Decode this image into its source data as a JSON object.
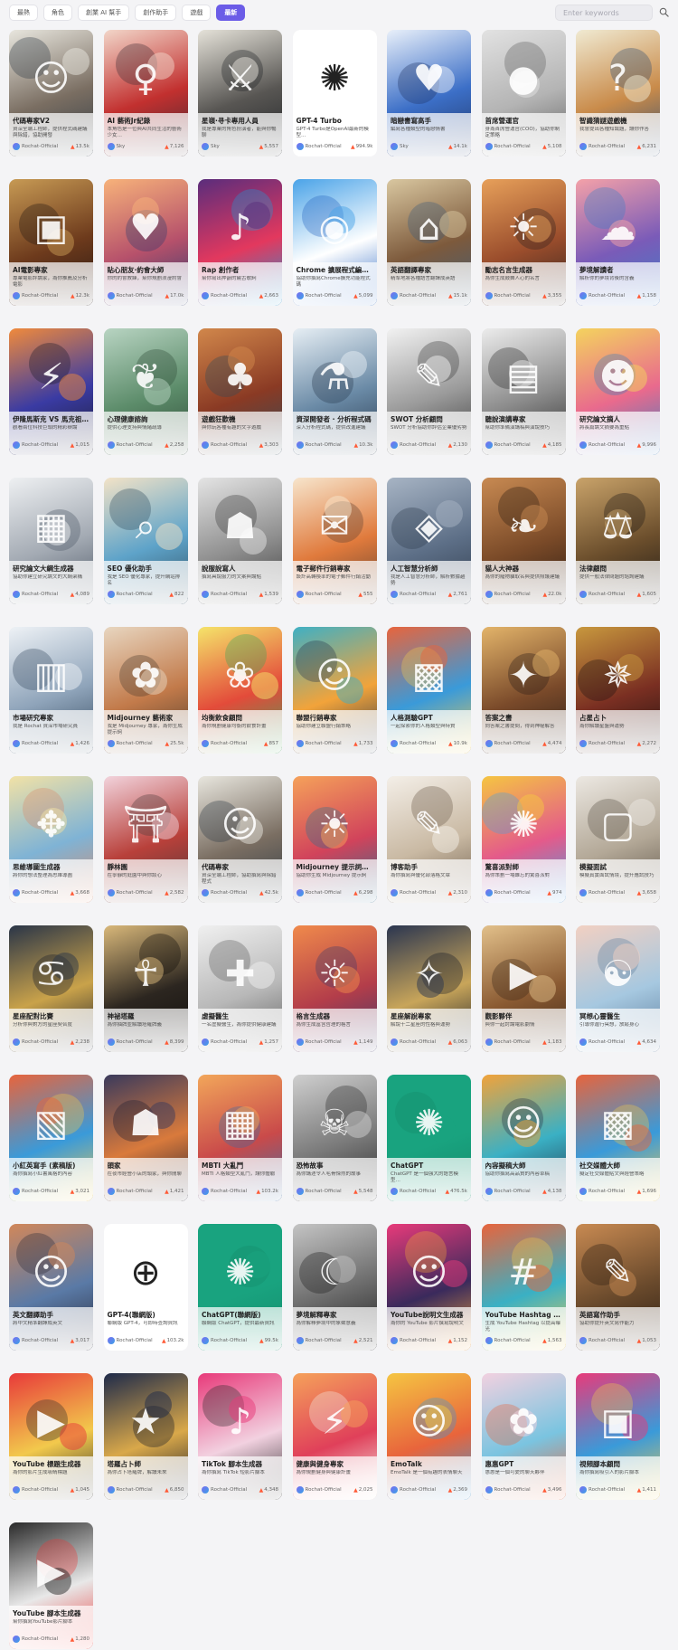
{
  "tabs": [
    {
      "label": "最熱",
      "active": false
    },
    {
      "label": "角色",
      "active": false
    },
    {
      "label": "創業 AI 幫手",
      "active": false
    },
    {
      "label": "創作助手",
      "active": false
    },
    {
      "label": "遊戲",
      "active": false
    },
    {
      "label": "最新",
      "active": true
    }
  ],
  "search": {
    "placeholder": "Enter keywords",
    "value": ""
  },
  "accent_color": "#6b5ce7",
  "cards": [
    {
      "title": "代碼專家V2",
      "desc": "資深全端工程師，提供程式碼建議與除錯，協助開發",
      "author": "Rochat-Official",
      "count": "13.5k",
      "colors": [
        "#e8e6de",
        "#7a6e62",
        "#2f3a44"
      ],
      "glyph": "☺"
    },
    {
      "title": "AI 藝術Jr紀錄",
      "desc": "本角色是一位與AI共同生活的藝術少女…",
      "author": "Sky",
      "count": "7,126",
      "colors": [
        "#f2d6c9",
        "#c2302f",
        "#3b2a34"
      ],
      "glyph": "♀"
    },
    {
      "title": "星嶺·寻卡專用人員",
      "desc": "我是專業的角色扮演者，能與你暢聊",
      "author": "Sky",
      "count": "5,557",
      "colors": [
        "#e5e2d9",
        "#585653",
        "#1f2226"
      ],
      "glyph": "⚔"
    },
    {
      "title": "GPT-4 Turbo",
      "desc": "GPT-4 Turbo是OpenAI最新的模型…",
      "author": "Rochat-Official",
      "count": "994.9k",
      "colors": [
        "#ffffff",
        "#ffffff",
        "#ffffff"
      ],
      "glyph": "✺"
    },
    {
      "title": "暗戀書寫高手",
      "desc": "編寫各種類型的暗戀情書",
      "author": "Sky",
      "count": "14.1k",
      "colors": [
        "#e9f0fa",
        "#3c6fc7",
        "#203463"
      ],
      "glyph": "♥"
    },
    {
      "title": "首席營運官",
      "desc": "身為首席營運官(COO)，協助你制定策略",
      "author": "Rochat-Official",
      "count": "5,108",
      "colors": [
        "#e2e2e2",
        "#b4b4b4",
        "#5f5f5f"
      ],
      "glyph": "●"
    },
    {
      "title": "智識猜謎遊戲機",
      "desc": "我會提出各種知識題，讓你作答",
      "author": "Rochat-Official",
      "count": "6,231",
      "colors": [
        "#f0ead2",
        "#c98b4a",
        "#2f4d73"
      ],
      "glyph": "?"
    },
    {
      "title": "AI電影專家",
      "desc": "專業電影評論家，為你推薦及分析電影",
      "author": "Rochat-Official",
      "count": "12.3k",
      "colors": [
        "#c79a54",
        "#6d3a1c",
        "#221612"
      ],
      "glyph": "▣"
    },
    {
      "title": "貼心朋友·約會大師",
      "desc": "你的約會教練，幫你規劃浪漫約會",
      "author": "Rochat-Official",
      "count": "17.0k",
      "colors": [
        "#f7b27a",
        "#b6516b",
        "#2b3a6d"
      ],
      "glyph": "♥"
    },
    {
      "title": "Rap 創作者",
      "desc": "幫你寫出押韻的饒舌歌詞",
      "author": "Rochat-Official",
      "count": "2,663",
      "colors": [
        "#5a2d7c",
        "#e3385e",
        "#1e9ad6"
      ],
      "glyph": "♪"
    },
    {
      "title": "Chrome 擴展程式編碼…",
      "desc": "協助你撰寫Chrome擴充功能程式碼",
      "author": "Rochat-Official",
      "count": "5,099",
      "colors": [
        "#4aa3e8",
        "#ffffff",
        "#2563c0"
      ],
      "glyph": "◉"
    },
    {
      "title": "英語翻譯專家",
      "desc": "精準地將各種語言翻譯成英語",
      "author": "Rochat-Official",
      "count": "15.1k",
      "colors": [
        "#d9c7a0",
        "#7d5a3c",
        "#3d5d7a"
      ],
      "glyph": "⌂"
    },
    {
      "title": "勵志名言生成器",
      "desc": "為你生成鼓舞人心的名言",
      "author": "Rochat-Official",
      "count": "3,355",
      "colors": [
        "#e7a05a",
        "#9a4d2c",
        "#2f2320"
      ],
      "glyph": "☀"
    },
    {
      "title": "夢境解讀者",
      "desc": "解析你的夢境背後的含義",
      "author": "Rochat-Official",
      "count": "1,158",
      "colors": [
        "#f4a1a8",
        "#7a5bb8",
        "#3d7fc7"
      ],
      "glyph": "☁"
    },
    {
      "title": "伊隆馬斯克 VS 馬克祖克伯",
      "desc": "觀看兩位科技巨頭的精彩辯論",
      "author": "Rochat-Official",
      "count": "1,015",
      "colors": [
        "#f08a3c",
        "#3a3ba3",
        "#1b1b2b"
      ],
      "glyph": "⚡"
    },
    {
      "title": "心理健康諮詢",
      "desc": "提供心理支持與情緒疏導",
      "author": "Rochat-Official",
      "count": "2,258",
      "colors": [
        "#b8d4c2",
        "#5c8c6a",
        "#2f4a37"
      ],
      "glyph": "❦"
    },
    {
      "title": "遊戲狂歡機",
      "desc": "與你玩各種有趣的文字遊戲",
      "author": "Rochat-Official",
      "count": "3,303",
      "colors": [
        "#d1874b",
        "#8a3a24",
        "#2f4b59"
      ],
      "glyph": "♣"
    },
    {
      "title": "資深開發者 · 分析程式碼",
      "desc": "深入分析程式碼，提供改進建議",
      "author": "Rochat-Official",
      "count": "10.3k",
      "colors": [
        "#e6eef4",
        "#6a8aa6",
        "#28384c"
      ],
      "glyph": "⚗"
    },
    {
      "title": "SWOT 分析顧問",
      "desc": "SWOT 分析協助你評估企業優劣勢",
      "author": "Rochat-Official",
      "count": "2,130",
      "colors": [
        "#f2f2f2",
        "#9a9a9a",
        "#3a3a3a"
      ],
      "glyph": "✎"
    },
    {
      "title": "聽說演講專家",
      "desc": "幫助你準備演講稿與演說技巧",
      "author": "Rochat-Official",
      "count": "4,185",
      "colors": [
        "#ececec",
        "#8c8c8c",
        "#2c2c2c"
      ],
      "glyph": "▤"
    },
    {
      "title": "研究論文摘人",
      "desc": "將長篇論文摘要為重點",
      "author": "Rochat-Official",
      "count": "9,996",
      "colors": [
        "#f4d35e",
        "#e96a8d",
        "#3a7fc1"
      ],
      "glyph": "☻"
    },
    {
      "title": "研究論文大綱生成器",
      "desc": "協助你建立研究論文的大綱架構",
      "author": "Rochat-Official",
      "count": "4,089",
      "colors": [
        "#eef0f2",
        "#a3aab3",
        "#4b5563"
      ],
      "glyph": "▦"
    },
    {
      "title": "SEO 優化助手",
      "desc": "我是 SEO 優化專家，提升網站排名",
      "author": "Rochat-Official",
      "count": "822",
      "colors": [
        "#f3e3c7",
        "#5ea3c9",
        "#2e4b5c"
      ],
      "glyph": "⌕"
    },
    {
      "title": "說服說寫人",
      "desc": "撰寫具說服力的文案與論點",
      "author": "Rochat-Official",
      "count": "1,539",
      "colors": [
        "#e4e4e4",
        "#8f8f8f",
        "#3a3a3a"
      ],
      "glyph": "☗"
    },
    {
      "title": "電子郵件行銷專家",
      "desc": "設計高轉換率的電子郵件行銷活動",
      "author": "Rochat-Official",
      "count": "555",
      "colors": [
        "#f7e5cc",
        "#e07a3c",
        "#5c4030"
      ],
      "glyph": "✉"
    },
    {
      "title": "人工智慧分析師",
      "desc": "我是人工智慧分析師，解析數據趨勢",
      "author": "Rochat-Official",
      "count": "2,761",
      "colors": [
        "#a7b4c4",
        "#5d6f87",
        "#2f3b4c"
      ],
      "glyph": "◈"
    },
    {
      "title": "貓人大神器",
      "desc": "為你的寵物貓取名與提供照護建議",
      "author": "Rochat-Official",
      "count": "22.0k",
      "colors": [
        "#c88a52",
        "#7a4a28",
        "#2c1c12"
      ],
      "glyph": "❧"
    },
    {
      "title": "法律顧問",
      "desc": "提供一般法律問題的諮詢建議",
      "author": "Rochat-Official",
      "count": "1,605",
      "colors": [
        "#c9a36a",
        "#6b4e2c",
        "#1c1814"
      ],
      "glyph": "⚖"
    },
    {
      "title": "市場研究專家",
      "desc": "我是 Rochat 資深市場研究員",
      "author": "Rochat-Official",
      "count": "1,426",
      "colors": [
        "#eef2f6",
        "#8fa4ba",
        "#34495e"
      ],
      "glyph": "▥"
    },
    {
      "title": "Midjourney 藝術家",
      "desc": "我是 Midjourney 專家，為你生成提示詞",
      "author": "Rochat-Official",
      "count": "25.5k",
      "colors": [
        "#e8d6c0",
        "#c27a4a",
        "#4a3a2c"
      ],
      "glyph": "✿"
    },
    {
      "title": "均衡飲食顧問",
      "desc": "為你規劃健康均衡的飲食計畫",
      "author": "Rochat-Official",
      "count": "857",
      "colors": [
        "#f5e46a",
        "#e34b3a",
        "#3aa65a"
      ],
      "glyph": "❀"
    },
    {
      "title": "聯盟行銷專家",
      "desc": "協助你建立聯盟行銷策略",
      "author": "Rochat-Official",
      "count": "1,733",
      "colors": [
        "#3fb0c4",
        "#f2a33a",
        "#25344a"
      ],
      "glyph": "☺"
    },
    {
      "title": "人格測驗GPT",
      "desc": "一起探索你的人格類型與特質",
      "author": "Rochat-Official",
      "count": "10.9k",
      "colors": [
        "#e8643c",
        "#3a9ad9",
        "#f2c94c"
      ],
      "glyph": "▩"
    },
    {
      "title": "答案之書",
      "desc": "向答案之書提問，得到神秘解答",
      "author": "Rochat-Official",
      "count": "4,474",
      "colors": [
        "#e3b46a",
        "#7a4a2a",
        "#2a1d16"
      ],
      "glyph": "✦"
    },
    {
      "title": "占星占卜",
      "desc": "為你解讀星盤與運勢",
      "author": "Rochat-Official",
      "count": "2,272",
      "colors": [
        "#c8983e",
        "#7a2f22",
        "#1c1210"
      ],
      "glyph": "✵"
    },
    {
      "title": "思維導圖生成器",
      "desc": "將你的想法整理為思維導圖",
      "author": "Rochat-Official",
      "count": "3,668",
      "colors": [
        "#f2e2a6",
        "#7fb3d5",
        "#d98a6a"
      ],
      "glyph": "✥"
    },
    {
      "title": "靜林園",
      "desc": "在寧靜的庭園中與你談心",
      "author": "Rochat-Official",
      "count": "2,582",
      "colors": [
        "#f2d3dc",
        "#b8403a",
        "#4a3a3a"
      ],
      "glyph": "⛩"
    },
    {
      "title": "代碼專家",
      "desc": "資深全端工程師，協助撰寫與除錯程式",
      "author": "Rochat-Official",
      "count": "42.5k",
      "colors": [
        "#e8e6de",
        "#7a6e62",
        "#2f3a44"
      ],
      "glyph": "☺"
    },
    {
      "title": "Midjourney 提示詞生成器",
      "desc": "協助你生成 Midjourney 提示詞",
      "author": "Rochat-Official",
      "count": "6,298",
      "colors": [
        "#f5a15a",
        "#d1435b",
        "#2a6f8f"
      ],
      "glyph": "☀"
    },
    {
      "title": "博客助手",
      "desc": "為你撰寫與優化部落格文章",
      "author": "Rochat-Official",
      "count": "2,310",
      "colors": [
        "#f4efe8",
        "#c9b9a3",
        "#6a5a48"
      ],
      "glyph": "✎"
    },
    {
      "title": "驚喜派對師",
      "desc": "為你策劃一場難忘的驚喜派對",
      "author": "Rochat-Official",
      "count": "974",
      "colors": [
        "#f5c542",
        "#e45a8a",
        "#4aa0e0"
      ],
      "glyph": "✺"
    },
    {
      "title": "模擬面試",
      "desc": "模擬真實面試情境，提升應試技巧",
      "author": "Rochat-Official",
      "count": "3,658",
      "colors": [
        "#ece8e2",
        "#b3a897",
        "#5a5044"
      ],
      "glyph": "▢"
    },
    {
      "title": "星座配對比賽",
      "desc": "分析你與對方的星座契合度",
      "author": "Rochat-Official",
      "count": "2,238",
      "colors": [
        "#2a3548",
        "#c9a24a",
        "#14192a"
      ],
      "glyph": "♋"
    },
    {
      "title": "神祕塔羅",
      "desc": "為你抽牌並解讀塔羅牌義",
      "author": "Rochat-Official",
      "count": "8,399",
      "colors": [
        "#d9b87a",
        "#2c2620",
        "#0e0c0a"
      ],
      "glyph": "☥"
    },
    {
      "title": "虛擬醫生",
      "desc": "一名虛擬醫生，為你提供健康建議",
      "author": "Rochat-Official",
      "count": "1,257",
      "colors": [
        "#f0f0f0",
        "#b8b8b8",
        "#5c5c5c"
      ],
      "glyph": "✚"
    },
    {
      "title": "格言生成器",
      "desc": "為你生成富含哲理的格言",
      "author": "Rochat-Official",
      "count": "1,149",
      "colors": [
        "#f08a4b",
        "#b33d4a",
        "#3b3a6b"
      ],
      "glyph": "☼"
    },
    {
      "title": "星座解說專家",
      "desc": "解說十二星座的性格與運勢",
      "author": "Rochat-Official",
      "count": "6,063",
      "colors": [
        "#2a3550",
        "#c8a55a",
        "#121826"
      ],
      "glyph": "✧"
    },
    {
      "title": "觀影夥伴",
      "desc": "與你一起討論電影劇情",
      "author": "Rochat-Official",
      "count": "1,183",
      "colors": [
        "#e2c08a",
        "#8a5a32",
        "#3a2618"
      ],
      "glyph": "▶"
    },
    {
      "title": "冥想心靈醫生",
      "desc": "引導你進行冥想，放鬆身心",
      "author": "Rochat-Official",
      "count": "4,634",
      "colors": [
        "#f2d0c2",
        "#a6c8e0",
        "#5a7a9a"
      ],
      "glyph": "☯"
    },
    {
      "title": "小紅英寫手 (素稿版)",
      "desc": "為你撰寫小紅書風格的內容",
      "author": "Rochat-Official",
      "count": "3,021",
      "colors": [
        "#e8643c",
        "#3a9ad9",
        "#f2c94c"
      ],
      "glyph": "▧"
    },
    {
      "title": "頭家",
      "desc": "在夜市經營小店的頭家，與你閒聊",
      "author": "Rochat-Official",
      "count": "1,421",
      "colors": [
        "#3a3a5c",
        "#d97a3c",
        "#1e1e30"
      ],
      "glyph": "☗"
    },
    {
      "title": "MBTI 大亂鬥",
      "desc": "MBTI 人格類型大亂鬥，讓你體驗",
      "author": "Rochat-Official",
      "count": "103.2k",
      "colors": [
        "#f2a65a",
        "#c94a4a",
        "#3a6ea5"
      ],
      "glyph": "▦"
    },
    {
      "title": "恐怖故事",
      "desc": "為你講述令人毛骨悚然的故事",
      "author": "Rochat-Official",
      "count": "5,548",
      "colors": [
        "#cfcfcf",
        "#7a7a7a",
        "#2a2a2a"
      ],
      "glyph": "☠"
    },
    {
      "title": "ChatGPT",
      "desc": "ChatGPT 是一個強大的語言模型…",
      "author": "Rochat-Official",
      "count": "476.5k",
      "colors": [
        "#19a37f",
        "#19a37f",
        "#158a6b"
      ],
      "glyph": "✺"
    },
    {
      "title": "內容擬稿大師",
      "desc": "協助你撰寫高品質的內容草稿",
      "author": "Rochat-Official",
      "count": "4,138",
      "colors": [
        "#f2a33a",
        "#3ab0c4",
        "#25344a"
      ],
      "glyph": "☺"
    },
    {
      "title": "社交媒體大師",
      "desc": "擬定社交媒體貼文與經營策略",
      "author": "Rochat-Official",
      "count": "1,696",
      "colors": [
        "#e8643c",
        "#3a9ad9",
        "#f2c94c"
      ],
      "glyph": "▩"
    },
    {
      "title": "英文翻譯助手",
      "desc": "將中文精準翻譯成英文",
      "author": "Rochat-Official",
      "count": "3,017",
      "colors": [
        "#d1875a",
        "#5a7aa6",
        "#2a2a3a"
      ],
      "glyph": "☺"
    },
    {
      "title": "GPT-4(聯網版)",
      "desc": "聯網版 GPT-4，可即時查詢資訊",
      "author": "Rochat-Official",
      "count": "103.2k",
      "colors": [
        "#ffffff",
        "#ffffff",
        "#ffffff"
      ],
      "glyph": "⊕"
    },
    {
      "title": "ChatGPT(聯網版)",
      "desc": "聯網版 ChatGPT，提供最新資訊",
      "author": "Rochat-Official",
      "count": "99.5k",
      "colors": [
        "#19a37f",
        "#19a37f",
        "#158a6b"
      ],
      "glyph": "✺"
    },
    {
      "title": "夢境解釋專家",
      "desc": "為你解釋夢境中的象徵意義",
      "author": "Rochat-Official",
      "count": "2,521",
      "colors": [
        "#c4c4c4",
        "#6a6a6a",
        "#1e1e1e"
      ],
      "glyph": "☾"
    },
    {
      "title": "YouTube說明文生成器",
      "desc": "為你的 YouTube 影片撰寫說明文",
      "author": "Rochat-Official",
      "count": "1,152",
      "colors": [
        "#e83a7a",
        "#3a2a5c",
        "#f2a33a"
      ],
      "glyph": "☺"
    },
    {
      "title": "YouTube Hashtag 生成器",
      "desc": "生成 YouTube Hashtag 以提高曝光",
      "author": "Rochat-Official",
      "count": "1,563",
      "colors": [
        "#e8643c",
        "#3ab0c4",
        "#f2c94c"
      ],
      "glyph": "#"
    },
    {
      "title": "英語寫作助手",
      "desc": "協助你提升英文寫作能力",
      "author": "Rochat-Official",
      "count": "1,053",
      "colors": [
        "#c88a52",
        "#6a4a2c",
        "#2a1c12"
      ],
      "glyph": "✎"
    },
    {
      "title": "YouTube 標題生成器",
      "desc": "為你的影片生成吸睛標題",
      "author": "Rochat-Official",
      "count": "1,045",
      "colors": [
        "#e83a3a",
        "#f2c94c",
        "#2a2a2a"
      ],
      "glyph": "▶"
    },
    {
      "title": "塔羅占卜師",
      "desc": "為你占卜塔羅牌，解讀未來",
      "author": "Rochat-Official",
      "count": "6,850",
      "colors": [
        "#1e2a4a",
        "#d9a84a",
        "#0e1426"
      ],
      "glyph": "★"
    },
    {
      "title": "TikTok 腳本生成器",
      "desc": "為你撰寫 TikTok 短影片腳本",
      "author": "Rochat-Official",
      "count": "4,348",
      "colors": [
        "#e83a7a",
        "#f2d1e0",
        "#2a2a2a"
      ],
      "glyph": "♪"
    },
    {
      "title": "健康與健身專家",
      "desc": "為你規劃健身與健康計畫",
      "author": "Rochat-Official",
      "count": "2,025",
      "colors": [
        "#f5a15a",
        "#e0405a",
        "#f4efe8"
      ],
      "glyph": "⚡"
    },
    {
      "title": "EmoTalk",
      "desc": "EmoTalk 是一個有趣的表情聊天",
      "author": "Rochat-Official",
      "count": "2,369",
      "colors": [
        "#f5c542",
        "#e8643c",
        "#3a9ad9"
      ],
      "glyph": "☺"
    },
    {
      "title": "惠惠GPT",
      "desc": "惠惠是一個可愛的聊天夥伴",
      "author": "Rochat-Official",
      "count": "3,496",
      "colors": [
        "#f2d1e0",
        "#7ac4e0",
        "#e8643c"
      ],
      "glyph": "✿"
    },
    {
      "title": "視頻腳本顧問",
      "desc": "為你撰寫吸引人的影片腳本",
      "author": "Rochat-Official",
      "count": "1,411",
      "colors": [
        "#e83a7a",
        "#3a9ad9",
        "#f2c94c"
      ],
      "glyph": "▣"
    },
    {
      "title": "YouTube 腳本生成器",
      "desc": "幫你撰寫YouTube影片腳本",
      "author": "Rochat-Official",
      "count": "1,280",
      "colors": [
        "#2a2a2a",
        "#e8e8e8",
        "#e83a3a"
      ],
      "glyph": "▶"
    }
  ]
}
